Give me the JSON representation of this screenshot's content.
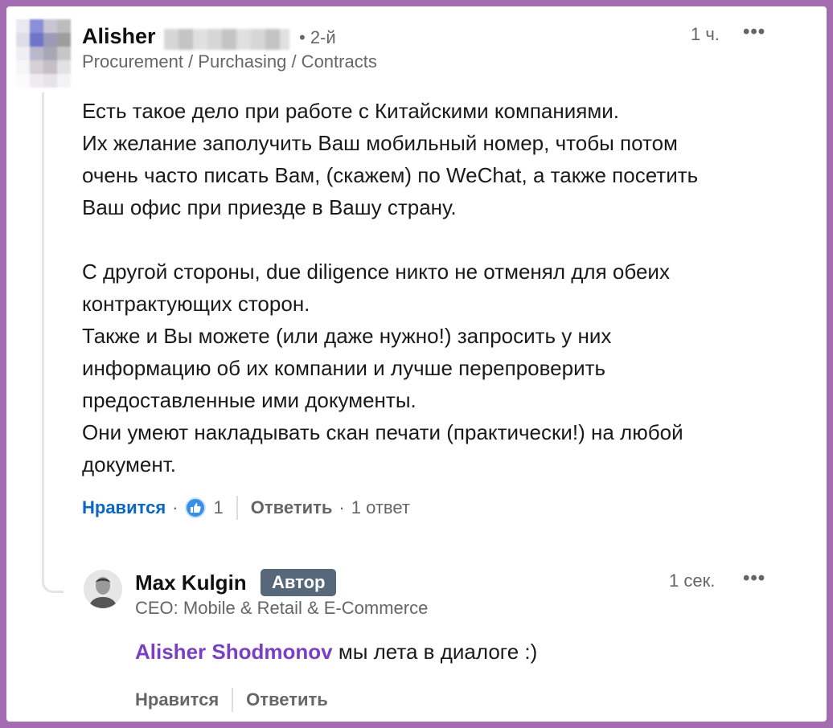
{
  "comment": {
    "author_first": "Alisher",
    "degree": "• 2-й",
    "headline": "Procurement / Purchasing / Contracts",
    "time": "1 ч.",
    "more": "•••",
    "paragraph1": [
      "Есть такое дело при работе с Китайскими компаниями.",
      "Их желание заполучить Ваш мобильный номер, чтобы потом",
      "очень часто писать Вам, (скажем) по WeChat, а также посетить",
      "Ваш офис при приезде в Вашу страну."
    ],
    "paragraph2": [
      "С другой стороны, due diligence никто не отменял для обеих",
      "контрактующих сторон.",
      "Также и Вы можете (или даже нужно!) запросить у них",
      "информацию об их компании и лучше перепроверить",
      "предоставленные ими документы.",
      "Они умеют накладывать скан печати (практически!) на любой",
      "документ."
    ],
    "like_label": "Нравится",
    "sep": "·",
    "like_count": "1",
    "reply_label": "Ответить",
    "replies_label": "1 ответ"
  },
  "reply": {
    "author": "Max Kulgin",
    "badge": "Автор",
    "headline": "CEO: Mobile & Retail & E-Commerce",
    "time": "1 сек.",
    "more": "•••",
    "mention": "Alisher Shodmonov",
    "text": "мы лета в диалоге :)",
    "like_label": "Нравится",
    "reply_label": "Ответить"
  },
  "colors": {
    "frame": "#a36bb0",
    "link_blue": "#0a66c2",
    "mention_purple": "#7b3fc4",
    "badge_bg": "#56687a"
  }
}
